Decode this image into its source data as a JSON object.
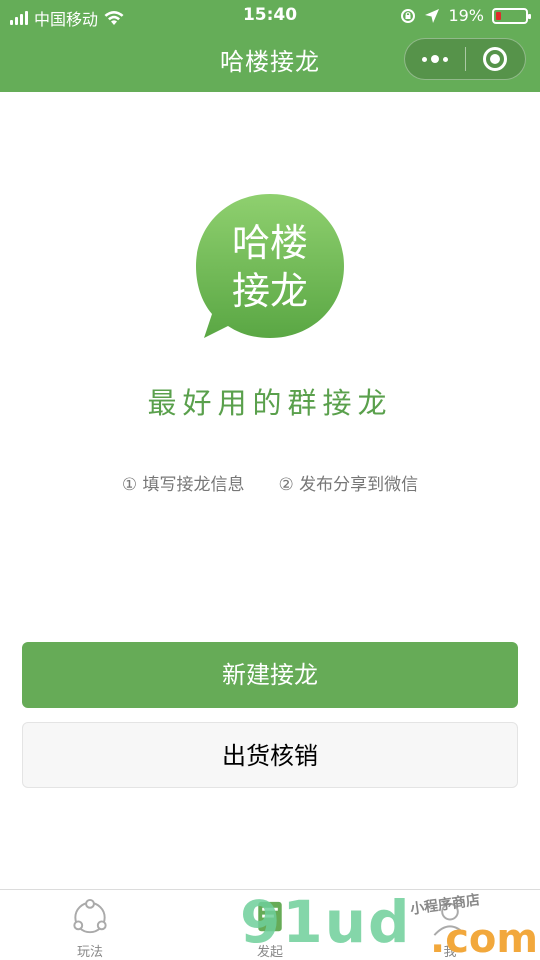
{
  "status_bar": {
    "carrier": "中国移动",
    "time": "15:40",
    "battery": "19%"
  },
  "nav": {
    "title": "哈楼接龙"
  },
  "logo": {
    "line1": "哈楼",
    "line2": "接龙"
  },
  "slogan": "最好用的群接龙",
  "steps": [
    {
      "number": "①",
      "label": "填写接龙信息"
    },
    {
      "number": "②",
      "label": "发布分享到微信"
    }
  ],
  "buttons": {
    "primary": "新建接龙",
    "secondary": "出货核销"
  },
  "tabbar": {
    "items": [
      {
        "label": "玩法",
        "icon": "share-icon"
      },
      {
        "label": "发起",
        "icon": "flag-icon"
      },
      {
        "label": "我",
        "icon": "user-icon"
      }
    ]
  },
  "watermark": {
    "brand": "91ud",
    "domain": ".com",
    "caption": "小程序商店"
  },
  "colors": {
    "brand_green": "#65ad58",
    "battery_low": "#e02b2b"
  }
}
